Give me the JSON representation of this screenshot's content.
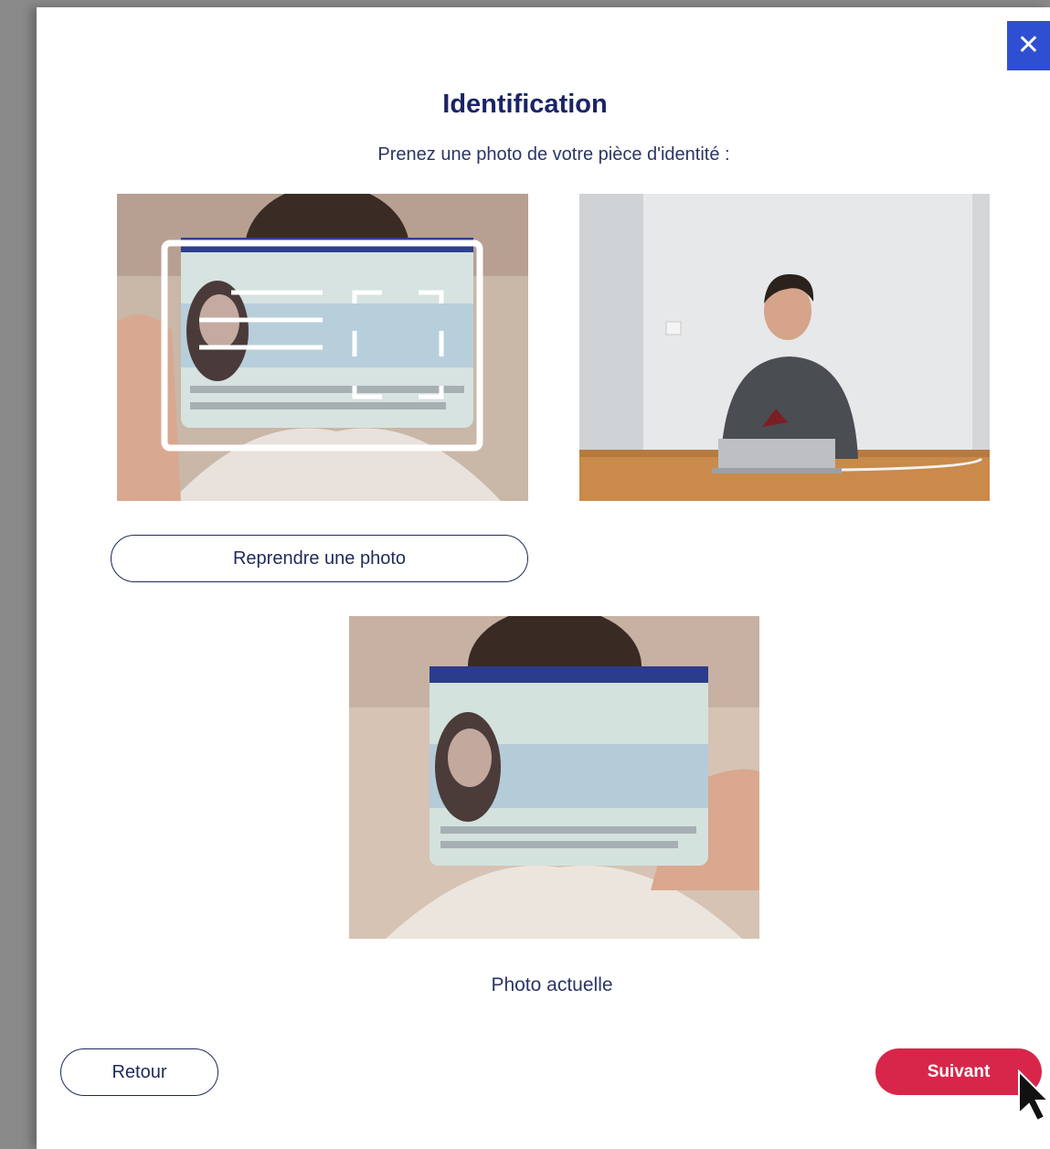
{
  "dialog": {
    "title": "Identification",
    "subtitle": "Prenez une photo de votre pièce d'identité :",
    "close_icon": "✕"
  },
  "buttons": {
    "retake": "Reprendre une photo",
    "back": "Retour",
    "next": "Suivant"
  },
  "current_photo_caption": "Photo actuelle",
  "colors": {
    "title": "#1a2466",
    "accent_blue": "#2f4fd3",
    "next_button": "#d8264a"
  }
}
